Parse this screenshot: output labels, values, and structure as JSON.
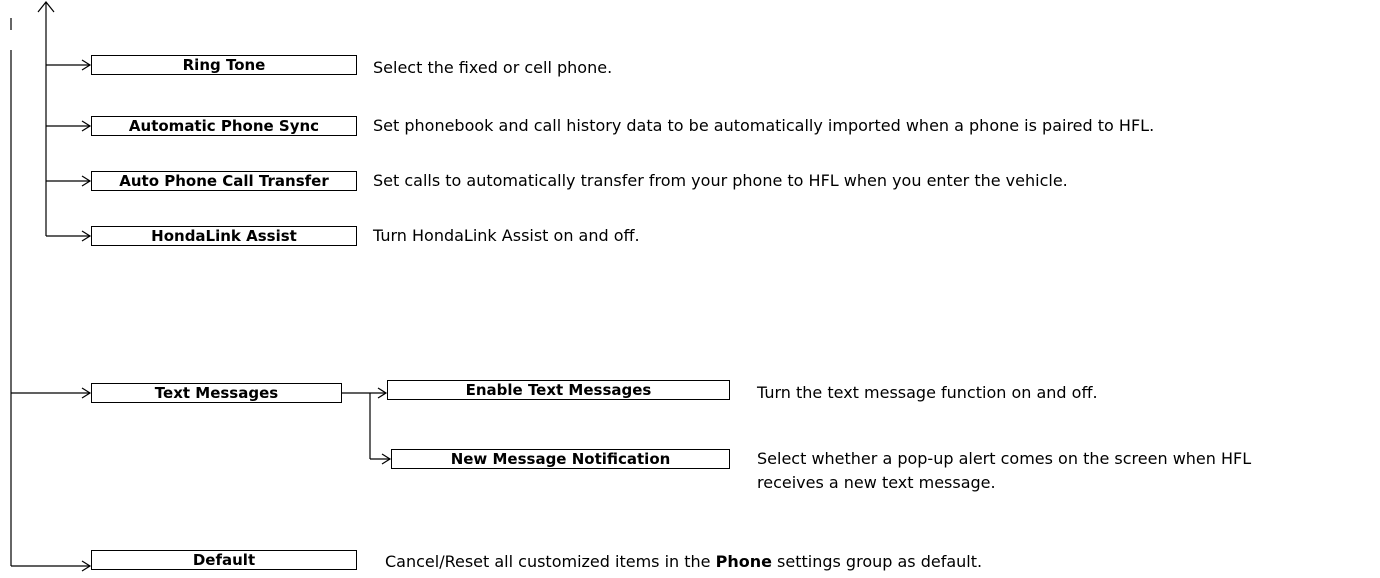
{
  "items": [
    {
      "label": "Ring Tone",
      "description": "Select the fixed or cell phone."
    },
    {
      "label": "Automatic Phone Sync",
      "description": "Set phonebook and call history data to be automatically imported when a phone is paired to HFL."
    },
    {
      "label": "Auto Phone Call Transfer",
      "description": "Set calls to automatically transfer from your phone to HFL when you enter the vehicle."
    },
    {
      "label": "HondaLink Assist",
      "description": "Turn HondaLink Assist on and off."
    }
  ],
  "text_messages": {
    "label": "Text Messages",
    "children": [
      {
        "label": "Enable Text Messages",
        "description": "Turn the text message function on and off."
      },
      {
        "label": "New Message Notification",
        "description_lines": [
          "Select whether a pop-up alert comes on the screen when HFL",
          "receives a new text message."
        ]
      }
    ]
  },
  "default_item": {
    "label": "Default",
    "description_before": "Cancel/Reset all customized items in the ",
    "description_bold": "Phone",
    "description_after": " settings group as default."
  }
}
